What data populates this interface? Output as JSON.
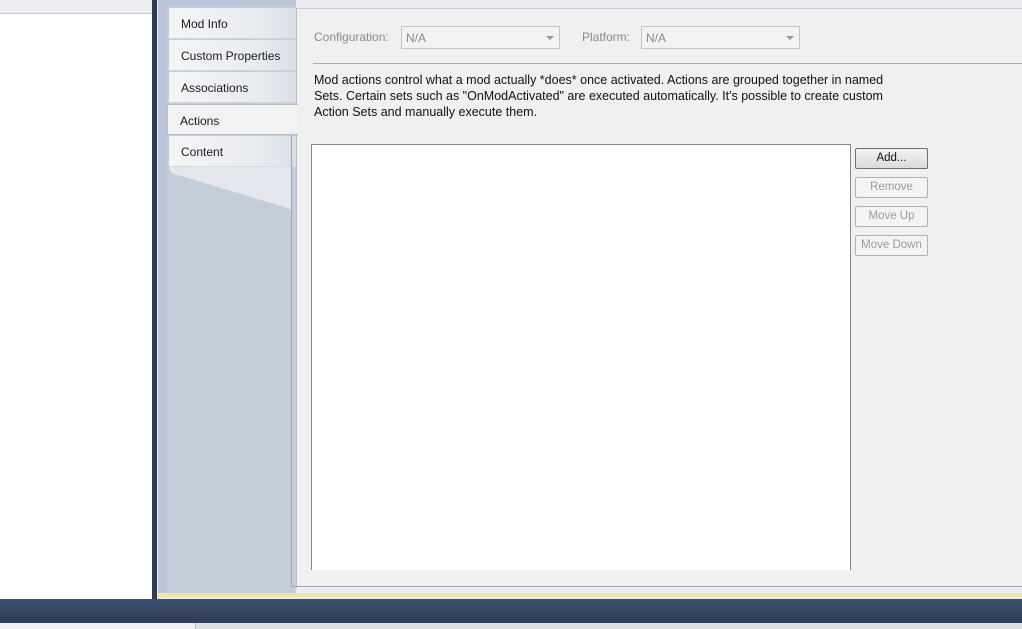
{
  "tabs": [
    {
      "label": "Mod Info",
      "active": false
    },
    {
      "label": "Custom Properties",
      "active": false
    },
    {
      "label": "Associations",
      "active": false
    },
    {
      "label": "Actions",
      "active": true
    },
    {
      "label": "Content",
      "active": false
    }
  ],
  "config": {
    "configuration_label": "Configuration:",
    "configuration_value": "N/A",
    "platform_label": "Platform:",
    "platform_value": "N/A"
  },
  "description": "Mod actions control what a mod actually *does* once activated.  Actions are grouped together in named\nSets.  Certain sets such as \"OnModActivated\" are executed automatically.  It's possible to create custom\nAction Sets and manually execute them.",
  "buttons": {
    "add": "Add...",
    "remove": "Remove",
    "move_up": "Move Up",
    "move_down": "Move Down"
  },
  "colors": {
    "tab_column": "#bac6d8",
    "panel": "#f0f0f0",
    "status_strip": "#2d3d5a",
    "accent_bar": "#f2e7a2"
  }
}
